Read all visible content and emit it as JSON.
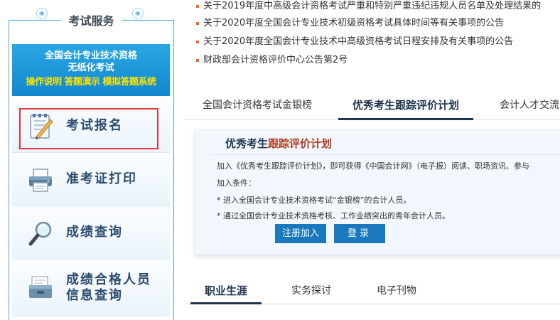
{
  "sidebar": {
    "title": "考试服务",
    "banner": {
      "line1": "全国会计专业技术资格",
      "line2": "无纸化考试",
      "line3": "操作说明 答题演示 模拟答题系统"
    },
    "items": [
      {
        "label": "考试报名",
        "icon": "exam-registration-icon"
      },
      {
        "label": "准考证打印",
        "icon": "printer-icon"
      },
      {
        "label": "成绩查询",
        "icon": "magnifier-icon"
      },
      {
        "label_line1": "成绩合格人员",
        "label_line2": "信息查询",
        "icon": "archive-box-icon"
      }
    ]
  },
  "notices": [
    "关于2019年度中高级会计资格考试严重和特别严重违纪违规人员名单及处理结果的",
    "关于2020年度全国会计专业技术初级资格考试具体时间等有关事项的公告",
    "关于2020年度全国会计专业技术中高级资格考试日程安排及有关事项的公告",
    "财政部会计资格评价中心公告第2号"
  ],
  "top_tabs": [
    "全国会计资格考试金银榜",
    "优秀考生跟踪评价计划",
    "会计人才交流"
  ],
  "panel": {
    "title_part1": "优秀考生",
    "title_part2": "跟踪评价计划",
    "line1": "加入《优秀考生跟踪评价计划》，即可获得《中国会计网》（电子报）阅读、职场资讯、参与",
    "line2": "加入条件：",
    "line3": "* 进入全国会计专业技术资格考试“金银榜”的会计人员。",
    "line4": "* 通过全国会计专业技术资格考核、工作业绩突出的青年会计人员。",
    "register_label": "注册加入",
    "login_label": "登录"
  },
  "bottom_tabs": [
    "职业生涯",
    "实务探讨",
    "电子刊物"
  ],
  "colors": {
    "accent_blue": "#1a78be",
    "highlight_red": "#e0363c",
    "banner_yellow": "#ffe300"
  }
}
